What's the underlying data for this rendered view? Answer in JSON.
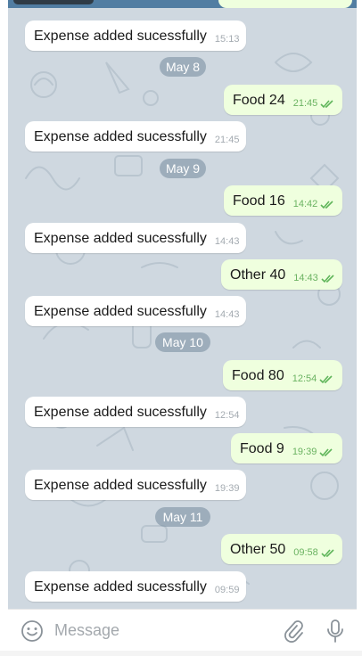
{
  "chat": {
    "messages": [
      {
        "direction": "in",
        "text": "Expense added sucessfully",
        "time": "15:13"
      },
      {
        "direction": "out",
        "text": "Food 24",
        "time": "21:45"
      },
      {
        "direction": "in",
        "text": "Expense added sucessfully",
        "time": "21:45"
      },
      {
        "direction": "out",
        "text": "Food 16",
        "time": "14:42"
      },
      {
        "direction": "in",
        "text": "Expense added sucessfully",
        "time": "14:43"
      },
      {
        "direction": "out",
        "text": "Other 40",
        "time": "14:43"
      },
      {
        "direction": "in",
        "text": "Expense added sucessfully",
        "time": "14:43"
      },
      {
        "direction": "out",
        "text": "Food 80",
        "time": "12:54"
      },
      {
        "direction": "in",
        "text": "Expense added sucessfully",
        "time": "12:54"
      },
      {
        "direction": "out",
        "text": "Food 9",
        "time": "19:39"
      },
      {
        "direction": "in",
        "text": "Expense added sucessfully",
        "time": "19:39"
      },
      {
        "direction": "out",
        "text": "Other 50",
        "time": "09:58"
      },
      {
        "direction": "in",
        "text": "Expense added sucessfully",
        "time": "09:59"
      }
    ],
    "dates": [
      "May 8",
      "May 9",
      "May 10",
      "May 11"
    ]
  },
  "input": {
    "placeholder": "Message",
    "emoji_icon": "smile-icon",
    "attach_icon": "paperclip-icon",
    "mic_icon": "microphone-icon"
  },
  "colors": {
    "wallpaper": "#cfd8e0",
    "incoming_bubble": "#ffffff",
    "outgoing_bubble": "#efffde",
    "outgoing_time": "#6bb362",
    "read_ticks": "#5fb55a",
    "date_pill": "#8da2b3"
  }
}
